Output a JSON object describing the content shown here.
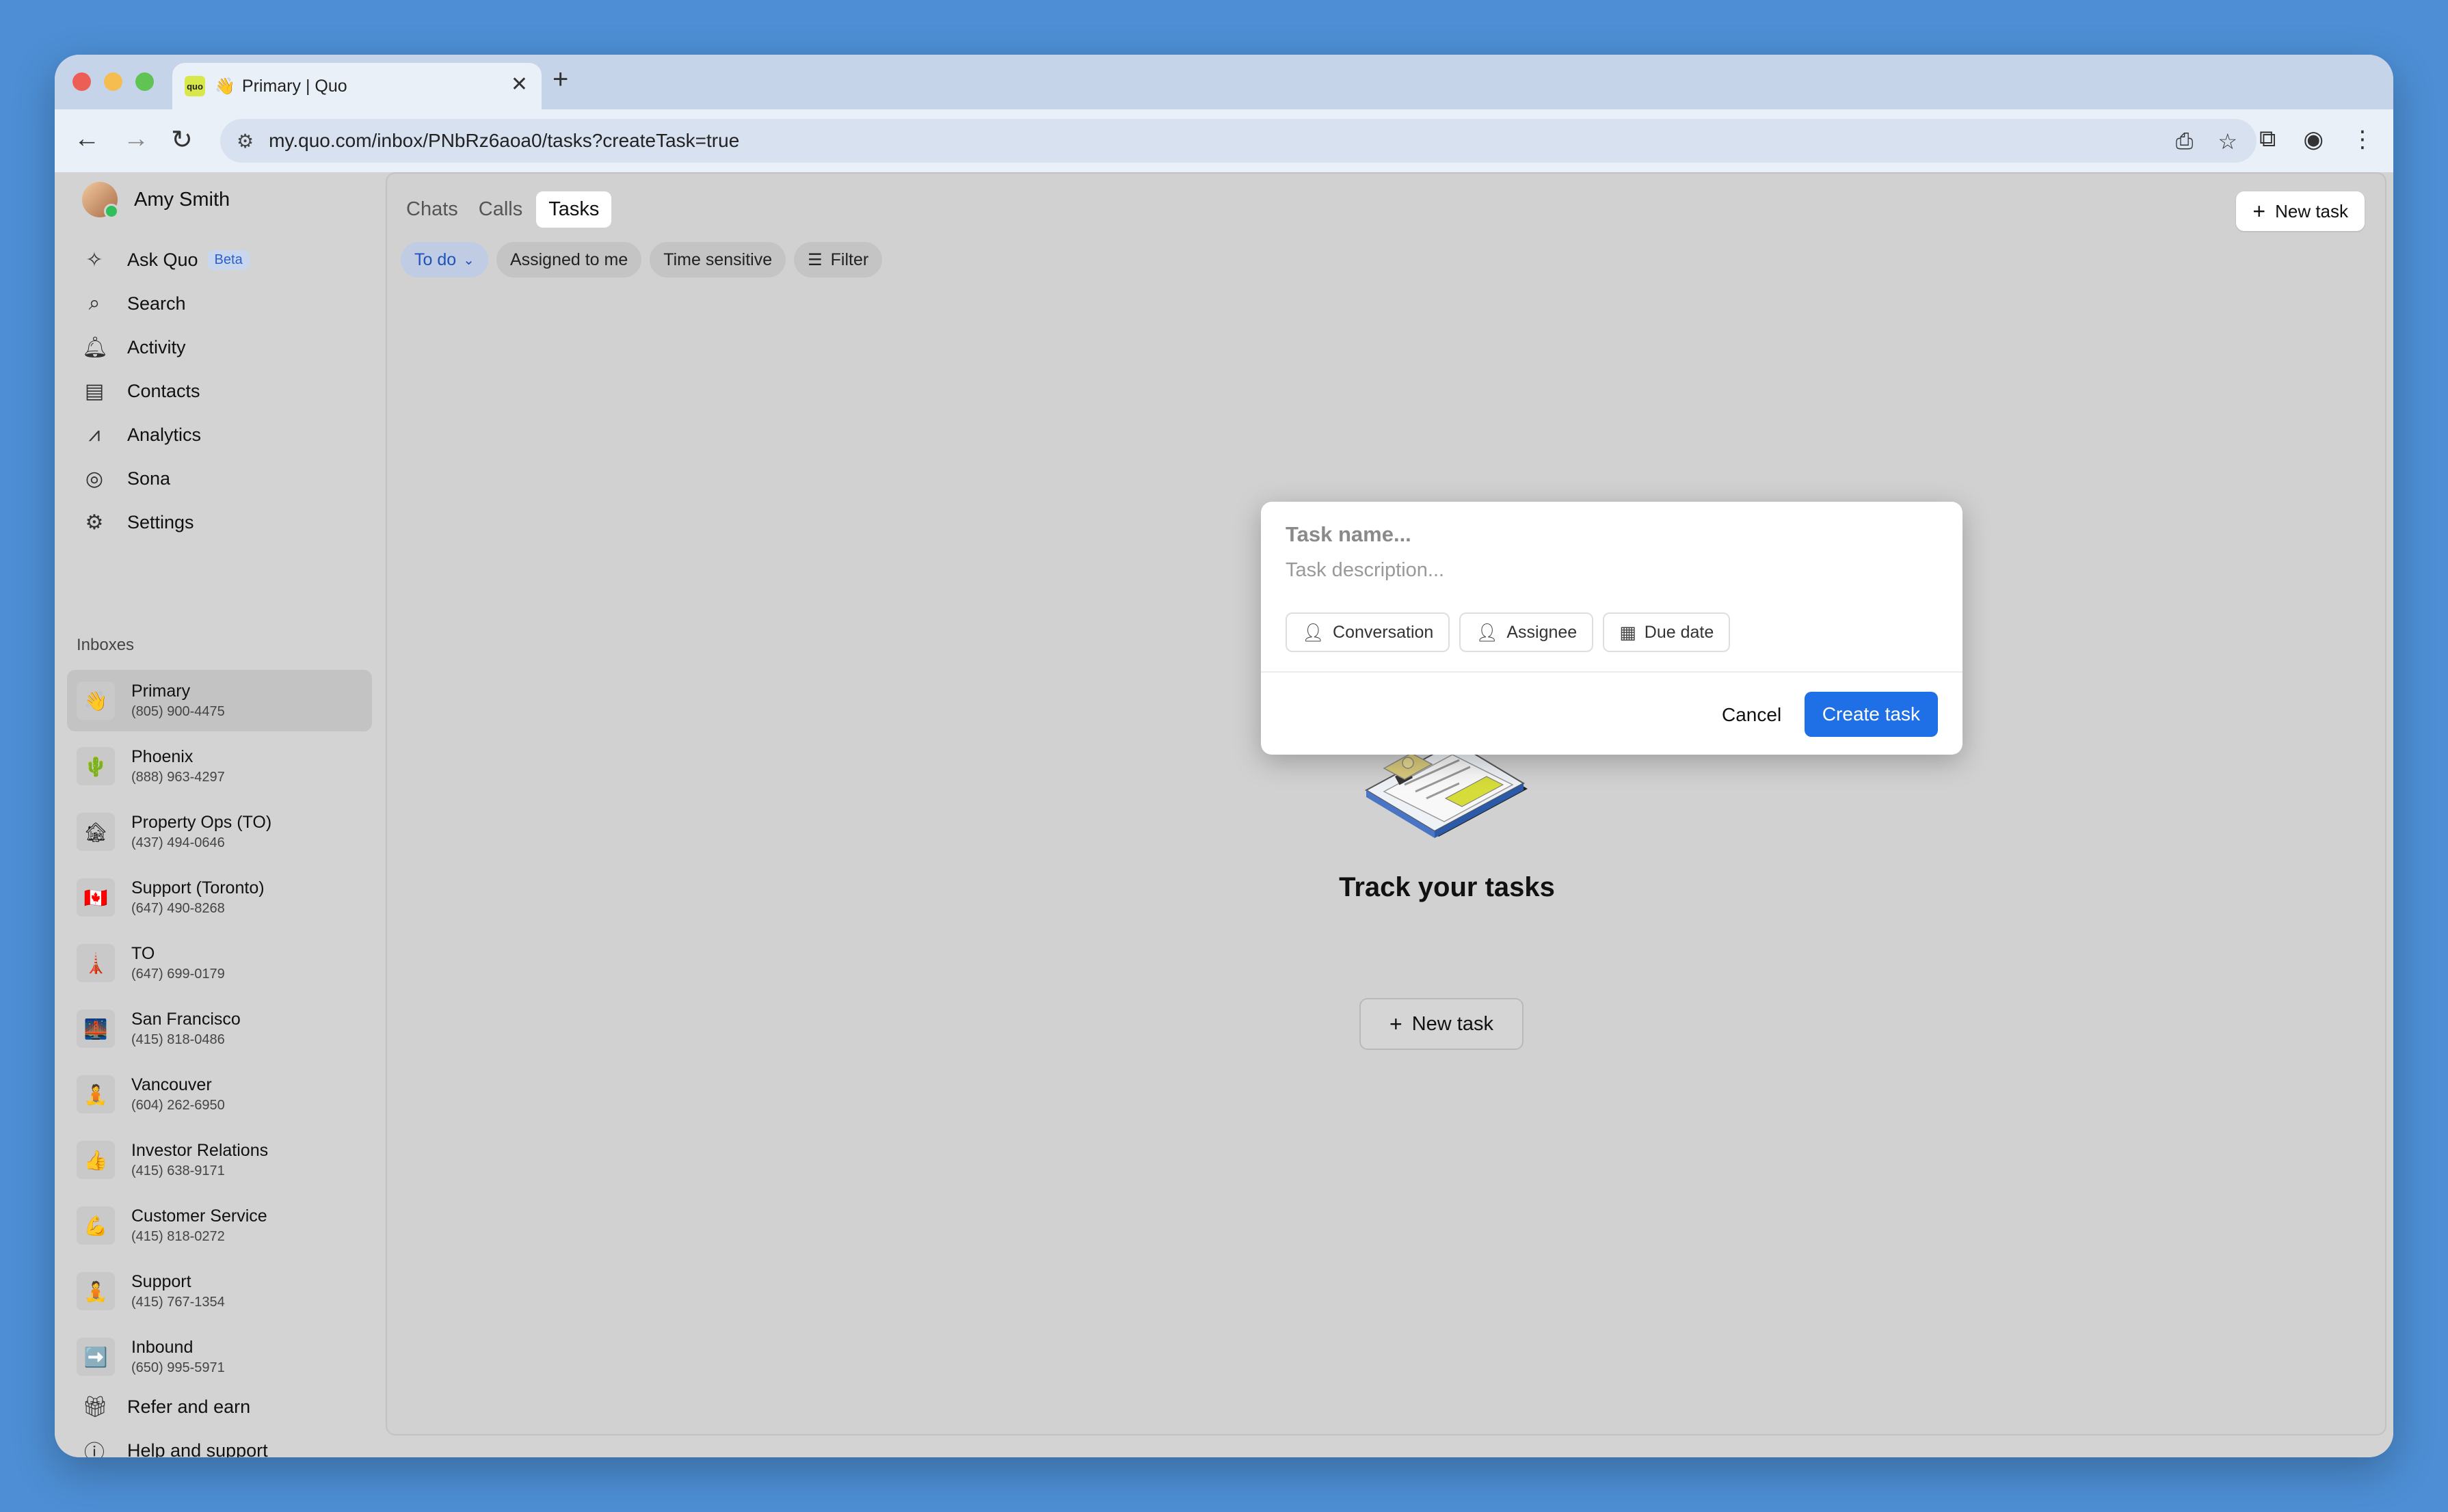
{
  "browser": {
    "tab_favicon": "quo",
    "tab_emoji": "👋",
    "tab_title": "Primary | Quo",
    "tab_close": "✕",
    "new_tab": "+",
    "url": "my.quo.com/inbox/PNbRz6aoa0/tasks?createTask=true"
  },
  "sidebar": {
    "user_name": "Amy Smith",
    "nav": [
      {
        "label": "Ask Quo",
        "icon": "sparkle-icon",
        "badge": "Beta"
      },
      {
        "label": "Search",
        "icon": "search-icon"
      },
      {
        "label": "Activity",
        "icon": "bell-icon"
      },
      {
        "label": "Contacts",
        "icon": "contacts-icon"
      },
      {
        "label": "Analytics",
        "icon": "analytics-icon"
      },
      {
        "label": "Sona",
        "icon": "sona-icon"
      },
      {
        "label": "Settings",
        "icon": "gear-icon"
      }
    ],
    "inboxes_label": "Inboxes",
    "inboxes": [
      {
        "name": "Primary",
        "phone": "(805) 900-4475",
        "emoji": "👋"
      },
      {
        "name": "Phoenix",
        "phone": "(888) 963-4297",
        "emoji": "🌵"
      },
      {
        "name": "Property Ops (TO)",
        "phone": "(437) 494-0646",
        "emoji": "🏚"
      },
      {
        "name": "Support (Toronto)",
        "phone": "(647) 490-8268",
        "emoji": "🇨🇦"
      },
      {
        "name": "TO",
        "phone": "(647) 699-0179",
        "emoji": "🗼"
      },
      {
        "name": "San Francisco",
        "phone": "(415) 818-0486",
        "emoji": "🌉"
      },
      {
        "name": "Vancouver",
        "phone": "(604) 262-6950",
        "emoji": "🧘"
      },
      {
        "name": "Investor Relations",
        "phone": "(415) 638-9171",
        "emoji": "👍"
      },
      {
        "name": "Customer Service",
        "phone": "(415) 818-0272",
        "emoji": "💪"
      },
      {
        "name": "Support",
        "phone": "(415) 767-1354",
        "emoji": "🧘"
      },
      {
        "name": "Inbound",
        "phone": "(650) 995-5971",
        "emoji": "➡️"
      }
    ],
    "refer_label": "Refer and earn",
    "help_label": "Help and support"
  },
  "main": {
    "tabs": [
      "Chats",
      "Calls",
      "Tasks"
    ],
    "new_task_label": "New task",
    "filters": {
      "todo": "To do",
      "assigned": "Assigned to me",
      "time_sensitive": "Time sensitive",
      "filter": "Filter"
    },
    "empty_title": "Track your tasks",
    "empty_button": "New task"
  },
  "modal": {
    "name_placeholder": "Task name...",
    "desc_placeholder": "Task description...",
    "chips": [
      "Conversation",
      "Assignee",
      "Due date"
    ],
    "cancel": "Cancel",
    "create": "Create task"
  },
  "colors": {
    "accent": "#1f6fe6",
    "desktop": "#4d8ed4"
  }
}
